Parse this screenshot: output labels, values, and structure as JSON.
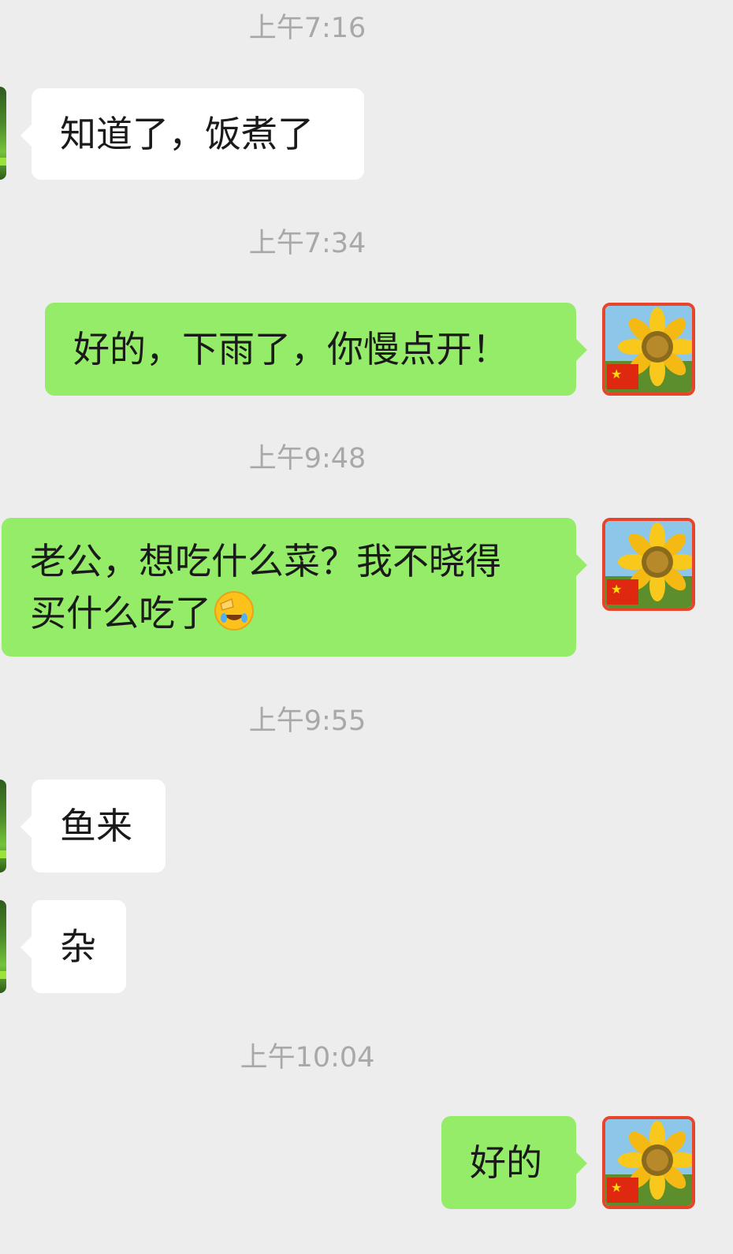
{
  "chat": {
    "messages": [
      {
        "type": "time",
        "text": "上午7:16"
      },
      {
        "type": "in",
        "text": "知道了，饭煮了"
      },
      {
        "type": "time",
        "text": "上午7:34"
      },
      {
        "type": "out",
        "text": "好的，下雨了，你慢点开！"
      },
      {
        "type": "time",
        "text": "上午9:48"
      },
      {
        "type": "out",
        "line1": "老公，想吃什么菜？我不晓得",
        "line2": "买什么吃了",
        "emoji": "face-palm-emoji"
      },
      {
        "type": "time",
        "text": "上午9:55"
      },
      {
        "type": "in",
        "text": "鱼来"
      },
      {
        "type": "in",
        "text": "杂"
      },
      {
        "type": "time",
        "text": "上午10:04"
      },
      {
        "type": "out",
        "text": "好的"
      }
    ]
  },
  "avatars": {
    "self_icon": "sunflower-with-china-flag-avatar",
    "contact_icon": "green-plant-avatar"
  },
  "colors": {
    "background": "#ededed",
    "outgoing_bubble": "#95ec69",
    "incoming_bubble": "#ffffff",
    "timestamp": "#a8a8a8"
  }
}
